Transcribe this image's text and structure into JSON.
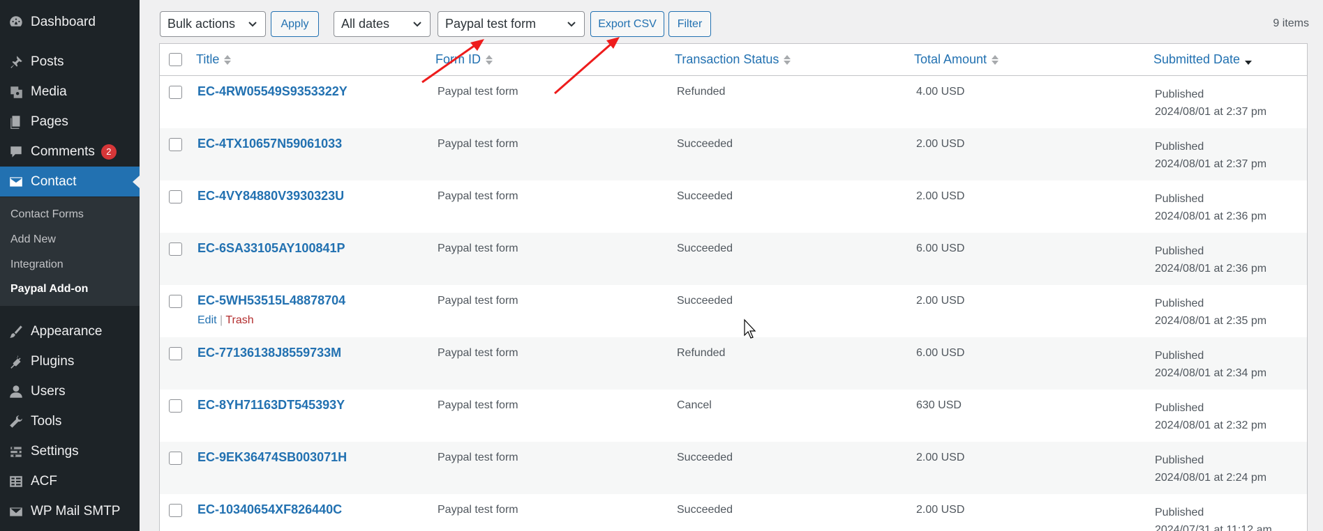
{
  "sidebar": {
    "items": [
      {
        "label": "Dashboard",
        "icon": "dashboard-icon"
      },
      {
        "label": "Posts",
        "icon": "pin-icon"
      },
      {
        "label": "Media",
        "icon": "media-icon"
      },
      {
        "label": "Pages",
        "icon": "pages-icon"
      },
      {
        "label": "Comments",
        "icon": "comments-icon",
        "badge": "2"
      },
      {
        "label": "Contact",
        "icon": "mail-icon",
        "active": true
      },
      {
        "label": "Appearance",
        "icon": "brush-icon"
      },
      {
        "label": "Plugins",
        "icon": "plug-icon"
      },
      {
        "label": "Users",
        "icon": "user-icon"
      },
      {
        "label": "Tools",
        "icon": "wrench-icon"
      },
      {
        "label": "Settings",
        "icon": "settings-icon"
      },
      {
        "label": "ACF",
        "icon": "table-icon"
      },
      {
        "label": "WP Mail SMTP",
        "icon": "envelope-icon"
      }
    ],
    "submenu": [
      {
        "label": "Contact Forms"
      },
      {
        "label": "Add New"
      },
      {
        "label": "Integration"
      },
      {
        "label": "Paypal Add-on",
        "current": true
      }
    ]
  },
  "toolbar": {
    "bulk_actions": "Bulk actions",
    "apply": "Apply",
    "all_dates": "All dates",
    "form_filter": "Paypal test form",
    "export_csv": "Export CSV",
    "filter": "Filter",
    "items_count": "9 items"
  },
  "table": {
    "columns": [
      "Title",
      "Form ID",
      "Transaction Status",
      "Total Amount",
      "Submitted Date"
    ],
    "sorted_column": "Submitted Date",
    "row_actions": {
      "edit": "Edit",
      "separator": "|",
      "trash": "Trash"
    },
    "rows": [
      {
        "title": "EC-4RW05549S9353322Y",
        "form": "Paypal test form",
        "status": "Refunded",
        "amount": "4.00 USD",
        "state": "Published",
        "date": "2024/08/01 at 2:37 pm"
      },
      {
        "title": "EC-4TX10657N59061033",
        "form": "Paypal test form",
        "status": "Succeeded",
        "amount": "2.00 USD",
        "state": "Published",
        "date": "2024/08/01 at 2:37 pm"
      },
      {
        "title": "EC-4VY84880V3930323U",
        "form": "Paypal test form",
        "status": "Succeeded",
        "amount": "2.00 USD",
        "state": "Published",
        "date": "2024/08/01 at 2:36 pm"
      },
      {
        "title": "EC-6SA33105AY100841P",
        "form": "Paypal test form",
        "status": "Succeeded",
        "amount": "6.00 USD",
        "state": "Published",
        "date": "2024/08/01 at 2:36 pm"
      },
      {
        "title": "EC-5WH53515L48878704",
        "form": "Paypal test form",
        "status": "Succeeded",
        "amount": "2.00 USD",
        "state": "Published",
        "date": "2024/08/01 at 2:35 pm",
        "hover": true
      },
      {
        "title": "EC-77136138J8559733M",
        "form": "Paypal test form",
        "status": "Refunded",
        "amount": "6.00 USD",
        "state": "Published",
        "date": "2024/08/01 at 2:34 pm"
      },
      {
        "title": "EC-8YH71163DT545393Y",
        "form": "Paypal test form",
        "status": "Cancel",
        "amount": "630 USD",
        "state": "Published",
        "date": "2024/08/01 at 2:32 pm"
      },
      {
        "title": "EC-9EK36474SB003071H",
        "form": "Paypal test form",
        "status": "Succeeded",
        "amount": "2.00 USD",
        "state": "Published",
        "date": "2024/08/01 at 2:24 pm"
      },
      {
        "title": "EC-10340654XF826440C",
        "form": "Paypal test form",
        "status": "Succeeded",
        "amount": "2.00 USD",
        "state": "Published",
        "date": "2024/07/31 at 11:12 am"
      }
    ]
  },
  "colors": {
    "sidebar_bg": "#1d2327",
    "accent": "#2271b1",
    "annotation_arrow": "#ee1c1c"
  }
}
